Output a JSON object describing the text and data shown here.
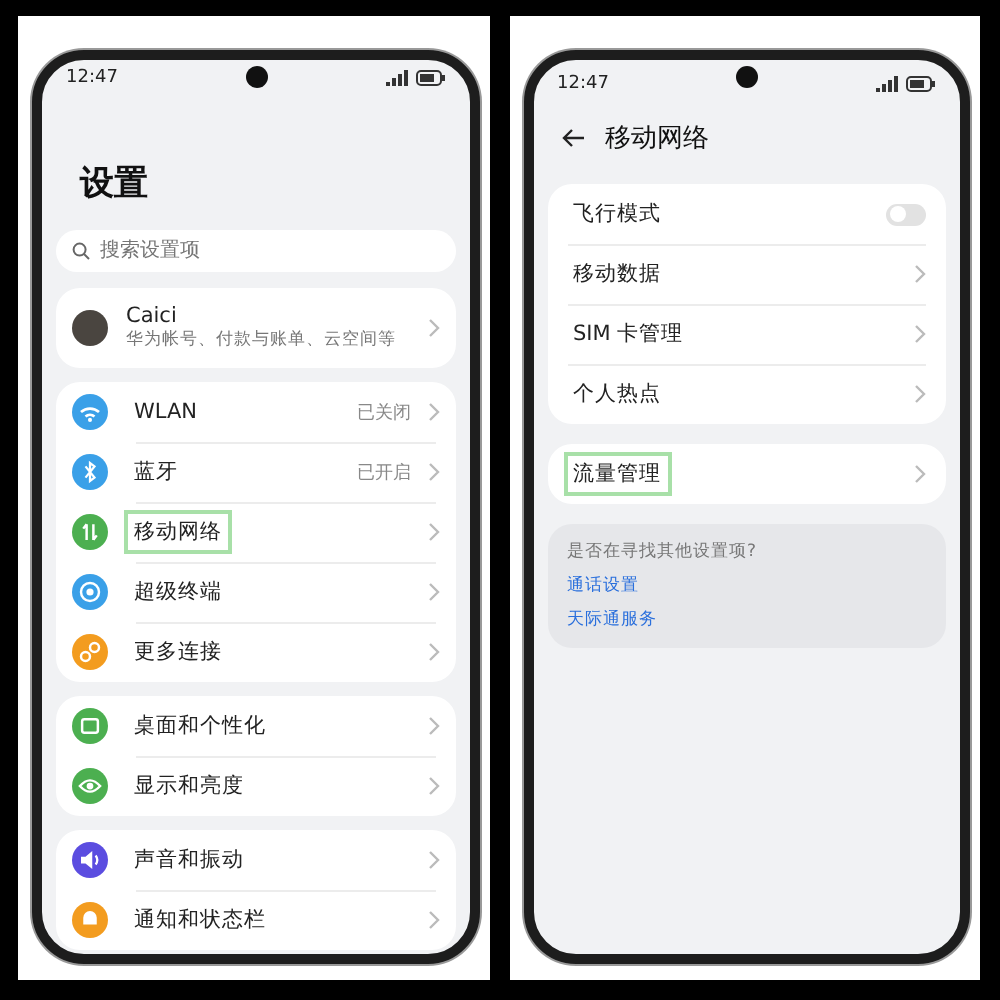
{
  "left_screen": {
    "status_bar": {
      "time": "12:47"
    },
    "title": "设置",
    "search": {
      "placeholder": "搜索设置项"
    },
    "account": {
      "name": "Caici",
      "subtitle": "华为帐号、付款与账单、云空间等"
    },
    "groups": [
      {
        "items": [
          {
            "label": "WLAN",
            "value": "已关闭",
            "color": "#3aa0e8",
            "highlighted": false
          },
          {
            "label": "蓝牙",
            "value": "已开启",
            "color": "#3aa0e8",
            "highlighted": false
          },
          {
            "label": "移动网络",
            "color": "#4caf50",
            "highlighted": true
          },
          {
            "label": "超级终端",
            "color": "#3aa0e8",
            "highlighted": false
          },
          {
            "label": "更多连接",
            "color": "#f39c1f",
            "highlighted": false
          }
        ]
      },
      {
        "items": [
          {
            "label": "桌面和个性化",
            "color": "#4caf50",
            "highlighted": false
          },
          {
            "label": "显示和亮度",
            "color": "#4caf50",
            "highlighted": false
          }
        ]
      },
      {
        "items": [
          {
            "label": "声音和振动",
            "color": "#5b4de0",
            "highlighted": false
          },
          {
            "label": "通知和状态栏",
            "color": "#f39c1f",
            "highlighted": false
          }
        ]
      }
    ]
  },
  "right_screen": {
    "status_bar": {
      "time": "12:47"
    },
    "title": "移动网络",
    "groups": [
      {
        "items": [
          {
            "kind": "switch",
            "label": "飞行模式",
            "on": false,
            "highlighted": false
          },
          {
            "kind": "link",
            "label": "移动数据",
            "highlighted": false
          },
          {
            "kind": "link",
            "label": "SIM 卡管理",
            "highlighted": false
          },
          {
            "kind": "link",
            "label": "个人热点",
            "highlighted": false
          }
        ]
      },
      {
        "items": [
          {
            "kind": "link",
            "label": "流量管理",
            "highlighted": true
          }
        ]
      }
    ],
    "suggestions": {
      "question": "是否在寻找其他设置项?",
      "links": [
        "通话设置",
        "天际通服务"
      ]
    }
  }
}
